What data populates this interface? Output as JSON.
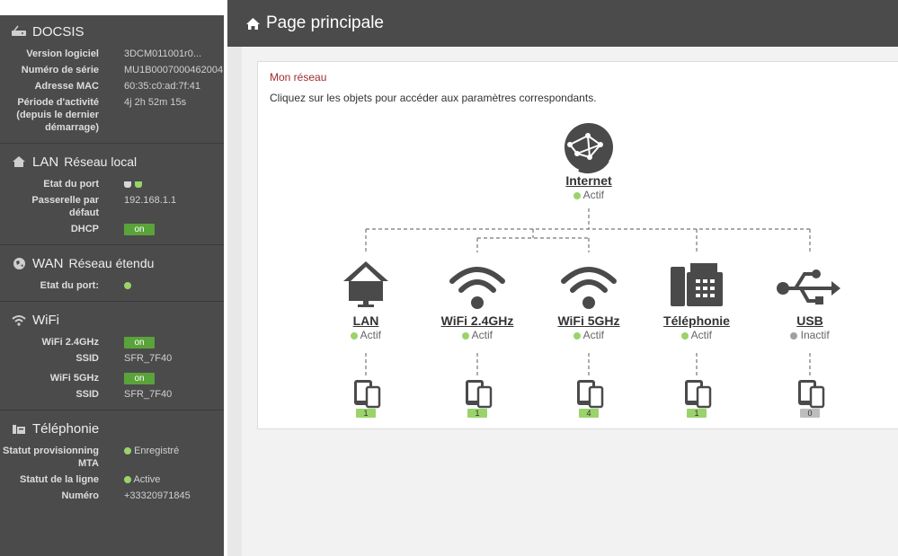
{
  "sidebar": {
    "docsis": {
      "title": "DOCSIS",
      "rows": [
        {
          "label": "Version logiciel",
          "value": "3DCM011001r0..."
        },
        {
          "label": "Numéro de série",
          "value": "MU1B0007000462004"
        },
        {
          "label": "Adresse MAC",
          "value": "60:35:c0:ad:7f:41"
        },
        {
          "label": "Période d'activité (depuis le dernier démarrage)",
          "value": "4j 2h 52m 15s"
        }
      ]
    },
    "lan": {
      "title": "LAN",
      "subtitle": "Réseau local",
      "port_label": "Etat du port",
      "gateway_label": "Passerelle par défaut",
      "gateway_value": "192.168.1.1",
      "dhcp_label": "DHCP",
      "dhcp_value": "on"
    },
    "wan": {
      "title": "WAN",
      "subtitle": "Réseau étendu",
      "port_label": "Etat du port:"
    },
    "wifi": {
      "title": "WiFi",
      "rows": [
        {
          "label": "WiFi 2.4GHz",
          "value": "on"
        },
        {
          "label": "SSID",
          "value": "SFR_7F40"
        },
        {
          "label": "WiFi 5GHz",
          "value": "on"
        },
        {
          "label": "SSID",
          "value": "SFR_7F40"
        }
      ]
    },
    "telephonie": {
      "title": "Téléphonie",
      "provisioning_label": "Statut provisionning MTA",
      "provisioning_value": "Enregistré",
      "line_label": "Statut de la ligne",
      "line_value": "Active",
      "number_label": "Numéro",
      "number_value": "+33320971845"
    }
  },
  "main": {
    "title": "Page principale",
    "panel_title": "Mon réseau",
    "panel_desc": "Cliquez sur les objets pour accéder aux paramètres correspondants.",
    "internet": {
      "label": "Internet",
      "status": "Actif"
    },
    "nodes": [
      {
        "label": "LAN",
        "status": "Actif",
        "count": "1",
        "icon": "house-icon"
      },
      {
        "label": "WiFi 2.4GHz",
        "status": "Actif",
        "count": "1",
        "icon": "wifi-icon"
      },
      {
        "label": "WiFi 5GHz",
        "status": "Actif",
        "count": "4",
        "icon": "wifi-icon"
      },
      {
        "label": "Téléphonie",
        "status": "Actif",
        "count": "1",
        "icon": "phone-icon"
      },
      {
        "label": "USB",
        "status": "Inactif",
        "count": "0",
        "icon": "usb-icon"
      }
    ]
  },
  "colors": {
    "sidebar_bg": "#4b4b4b",
    "active_green": "#9ad36a",
    "on_badge": "#5aa33a",
    "inactive_grey": "#a0a0a0",
    "title_red": "#a12d2d"
  }
}
